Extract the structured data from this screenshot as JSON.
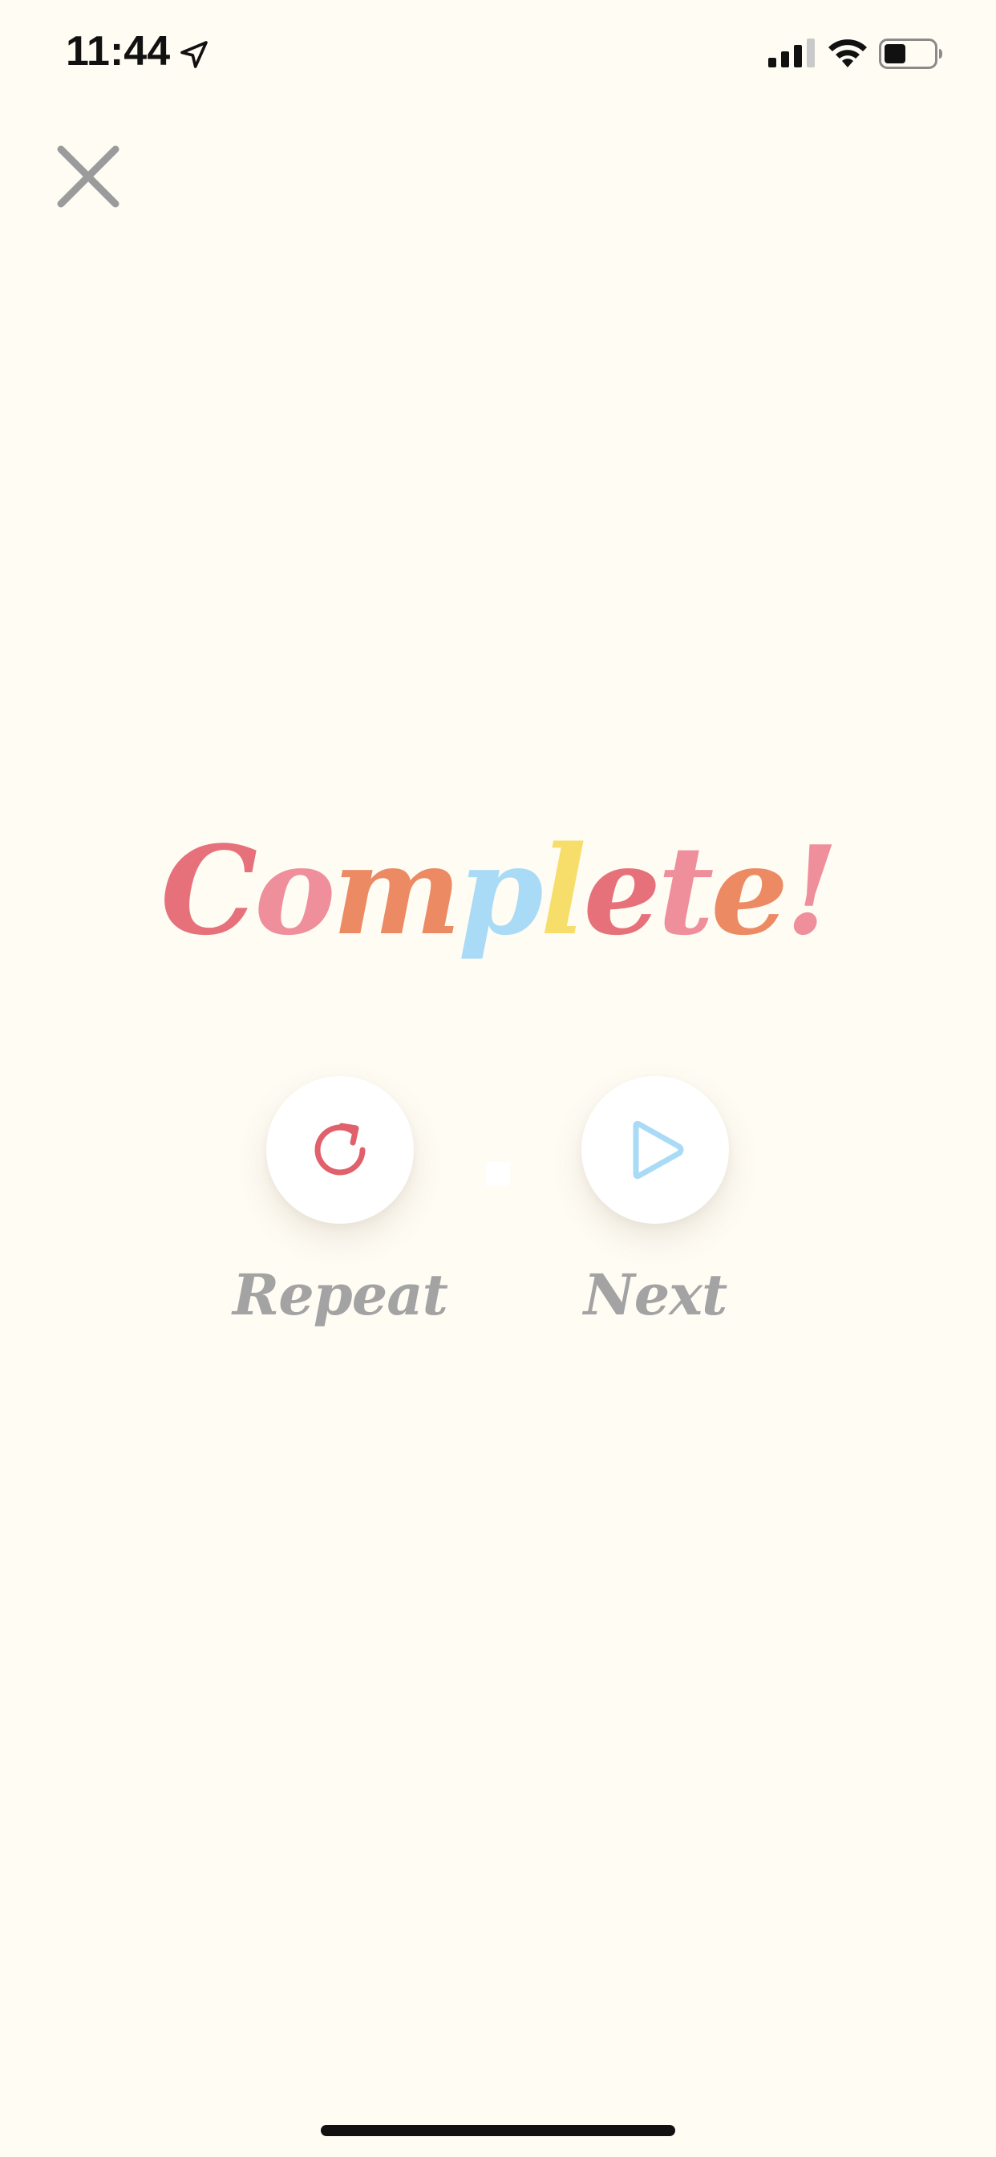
{
  "status_bar": {
    "time": "11:44",
    "icons": [
      "location-arrow-icon",
      "cellular-signal-icon",
      "wifi-icon",
      "battery-icon"
    ]
  },
  "close": {
    "icon": "close-icon",
    "color": "#9b9b9b"
  },
  "title": {
    "letters": [
      {
        "char": "C",
        "color": "#e6717b"
      },
      {
        "char": "o",
        "color": "#ef8f9b"
      },
      {
        "char": "m",
        "color": "#ec8a63"
      },
      {
        "char": "p",
        "color": "#a9dbf6"
      },
      {
        "char": "l",
        "color": "#f7de6b"
      },
      {
        "char": "e",
        "color": "#e6717b"
      },
      {
        "char": "t",
        "color": "#ef8f9b"
      },
      {
        "char": "e",
        "color": "#ec8a63"
      },
      {
        "char": "!",
        "color": "#ef8f9b"
      }
    ]
  },
  "actions": {
    "repeat": {
      "label": "Repeat",
      "icon": "repeat-icon",
      "icon_color": "#e0606b"
    },
    "next": {
      "label": "Next",
      "icon": "play-icon",
      "icon_color": "#a9dbf6"
    }
  },
  "colors": {
    "background": "#fffcf4",
    "label": "#a4a3a3"
  }
}
